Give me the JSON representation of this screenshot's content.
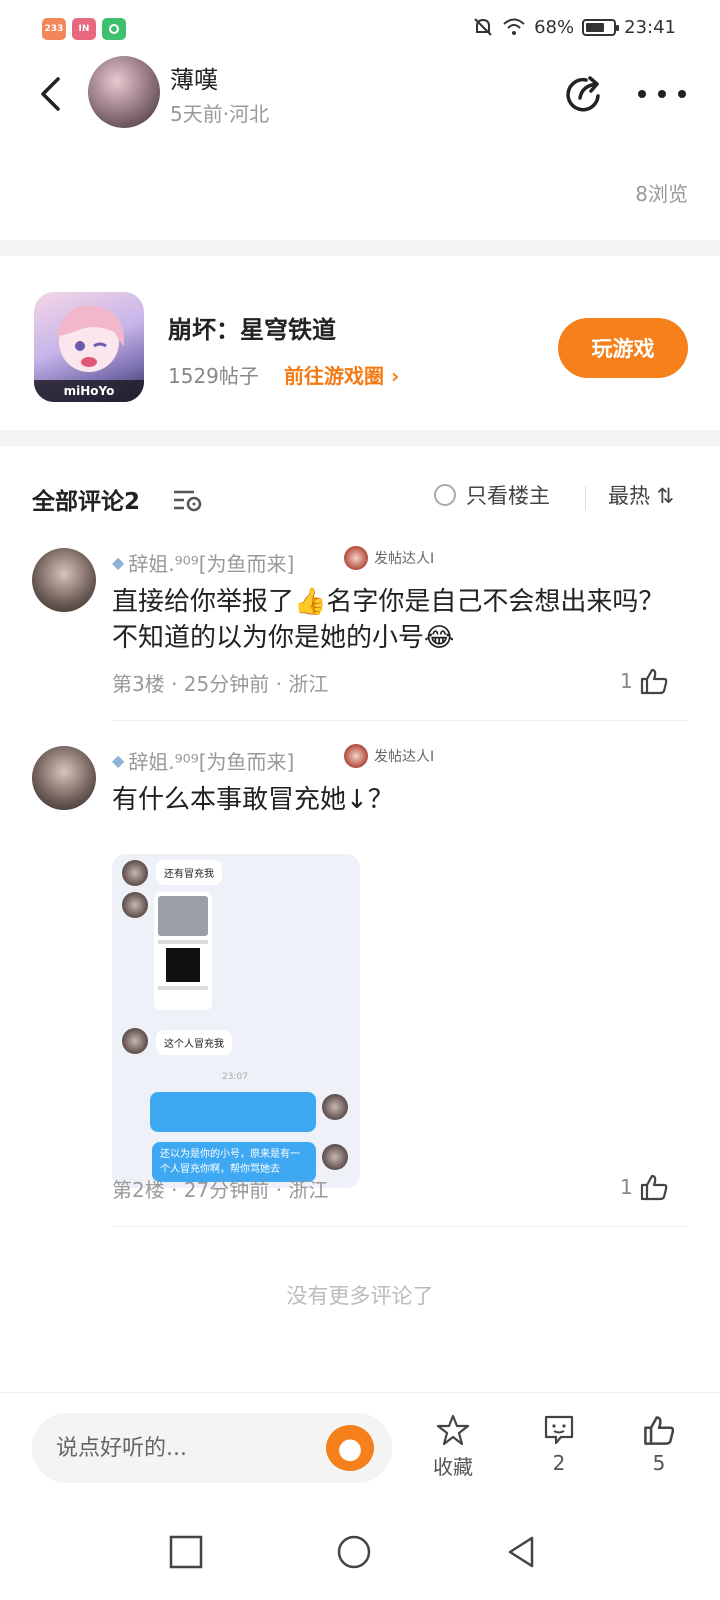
{
  "status_bar": {
    "app_icons": [
      {
        "label": "233",
        "color": "#f2875a"
      },
      {
        "label": "IN",
        "color": "#e7687f"
      },
      {
        "label": "",
        "color": "#3cc06e"
      }
    ],
    "battery": "68%",
    "battery_level": 0.68,
    "time": "23:41"
  },
  "header": {
    "author_name": "薄嘆",
    "author_meta": "5天前·河北"
  },
  "post": {
    "views": "8浏览"
  },
  "game": {
    "title": "崩坏：星穹铁道",
    "posts": "1529帖子",
    "link": "前往游戏圈 ›",
    "logo": "miHoYo",
    "play_label": "玩游戏"
  },
  "comments_header": {
    "title": "全部评论2",
    "only_op": "只看楼主",
    "sort": "最热 ⇅"
  },
  "comments": [
    {
      "name": "辞姐.⁹⁰⁹[为鱼而来]",
      "badge": "发帖达人I",
      "text": "直接给你举报了👍名字你是自己不会想出来吗？不知道的以为你是她的小号😂",
      "meta": "第3楼 · 25分钟前 · 浙江",
      "likes": "1"
    },
    {
      "name": "辞姐.⁹⁰⁹[为鱼而来]",
      "badge": "发帖达人I",
      "text": "有什么本事敢冒充她↓？",
      "meta": "第2楼 · 27分钟前 · 浙江",
      "likes": "1",
      "image": {
        "msg1": "还有冒充我",
        "msg2": "这个人冒充我",
        "time": "23:07",
        "msg3": "还以为是你的小号，原来是有一个人冒充你啊，帮你骂她去"
      }
    }
  ],
  "no_more": "没有更多评论了",
  "bottom_bar": {
    "input_placeholder": "说点好听的...",
    "favorite_label": "收藏",
    "comment_count": "2",
    "like_count": "5"
  }
}
